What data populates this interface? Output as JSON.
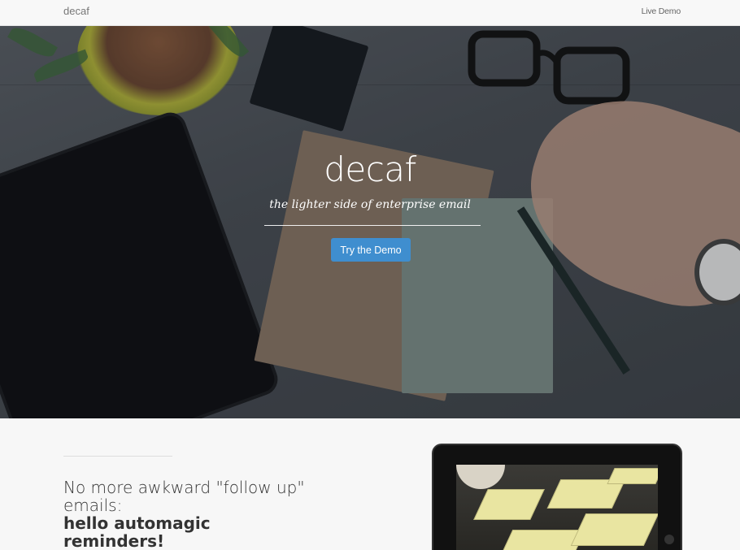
{
  "navbar": {
    "brand": "decaf",
    "live_demo": "Live Demo"
  },
  "hero": {
    "title": "decaf",
    "subtitle": "the lighter side of enterprise email",
    "cta": "Try the Demo"
  },
  "feature": {
    "line1": "No more awkward \"follow up\"",
    "line2": "emails:",
    "emphasis": "hello automagic reminders!"
  },
  "colors": {
    "accent": "#3f8ecf",
    "navbar_bg": "#f8f8f8",
    "page_bg": "#f7f7f7"
  }
}
